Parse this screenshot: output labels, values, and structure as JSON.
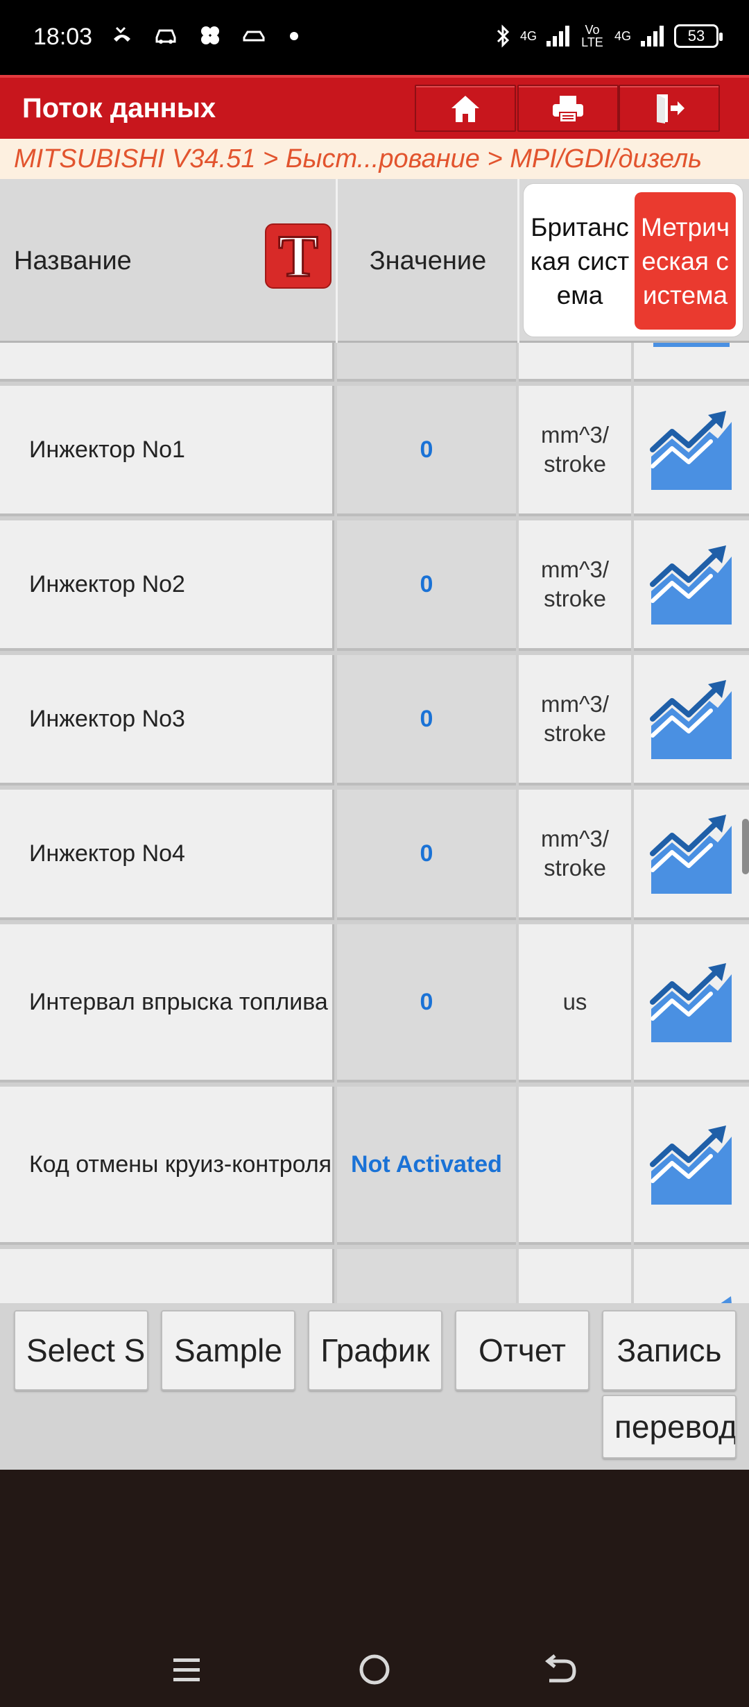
{
  "status_bar": {
    "time": "18:03",
    "left_icons": [
      "missed-call-icon",
      "car-icon",
      "flower-icon",
      "car-key-icon",
      "dot-icon"
    ],
    "network1": "4G",
    "volte": "Vo LTE",
    "network2": "4G",
    "battery": "53"
  },
  "header": {
    "title": "Поток данных",
    "buttons": [
      "home-icon",
      "print-icon",
      "exit-icon"
    ]
  },
  "breadcrumb": "MITSUBISHI V34.51 > Быст...рование > MPI/GDI/дизель",
  "table_header": {
    "name": "Название",
    "t_icon": "T",
    "value": "Значение",
    "unit_imperial": "Британская система",
    "unit_metric": "Метрическая система"
  },
  "rows": [
    {
      "name": "Инжектор No1",
      "value": "0",
      "unit": "mm^3/ stroke"
    },
    {
      "name": "Инжектор No2",
      "value": "0",
      "unit": "mm^3/ stroke"
    },
    {
      "name": "Инжектор No3",
      "value": "0",
      "unit": "mm^3/ stroke"
    },
    {
      "name": "Инжектор No4",
      "value": "0",
      "unit": "mm^3/ stroke"
    },
    {
      "name": "Интервал  впрыска топлива",
      "value": "0",
      "unit": "us"
    },
    {
      "name": "Код отмены круиз-контроля",
      "value": "Not Activated",
      "unit": ""
    }
  ],
  "toolbar": {
    "select": "Select S",
    "sample": "Sample",
    "graph": "График",
    "report": "Отчет",
    "record": "Запись",
    "translate": "перевод"
  },
  "colors": {
    "header_red": "#c8161d",
    "breadcrumb_text": "#e2542e",
    "value_blue": "#1a72d6",
    "metric_red": "#ea3a2f",
    "graph_blue": "#4a90e2"
  }
}
